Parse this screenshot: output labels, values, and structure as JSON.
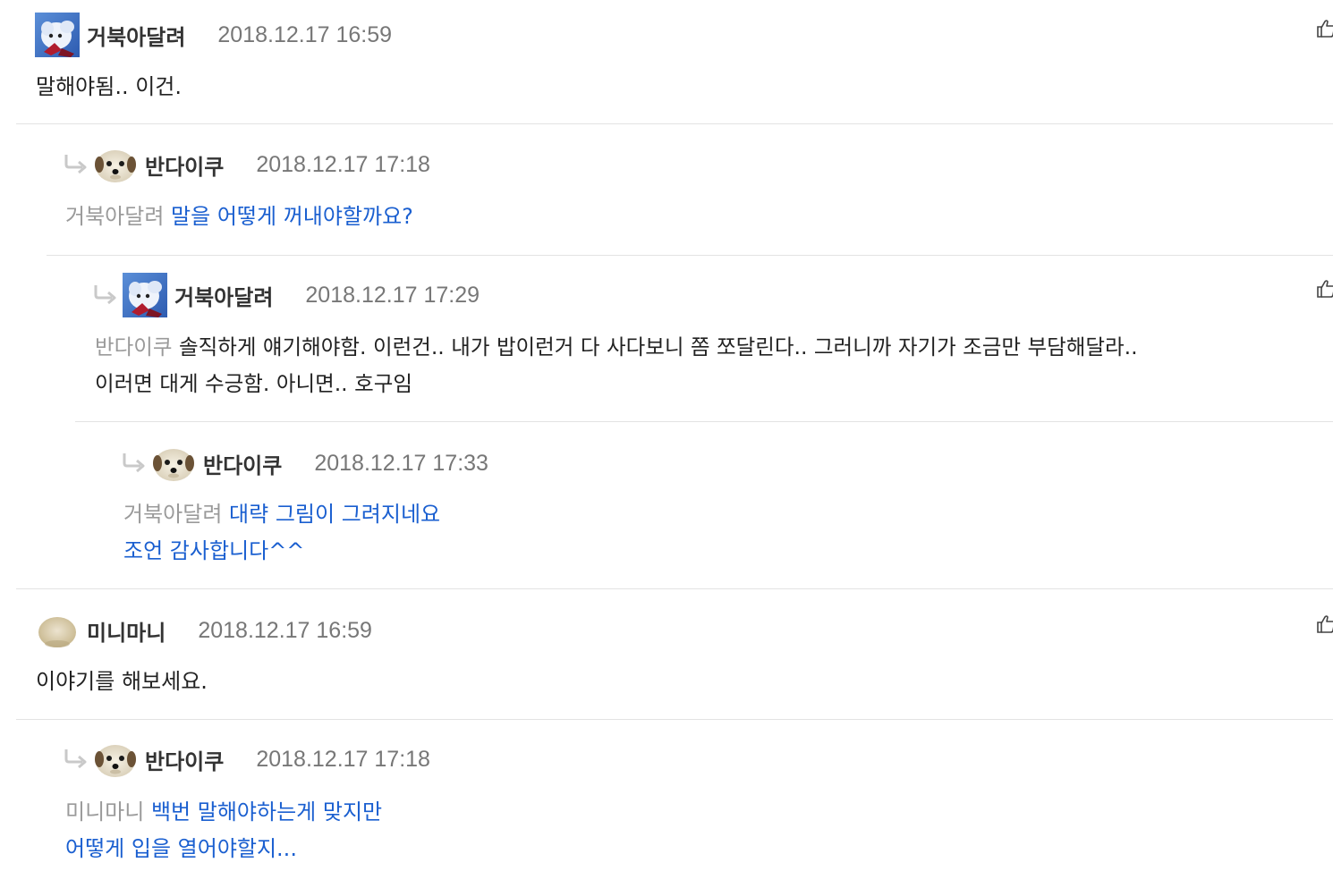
{
  "comments": [
    {
      "author": "거북아달려",
      "date": "2018.12.17 16:59",
      "text": "말해야됨.. 이건."
    },
    {
      "author": "반다이쿠",
      "date": "2018.12.17 17:18",
      "mention": "거북아달려",
      "text": "말을 어떻게 꺼내야할까요?"
    },
    {
      "author": "거북아달려",
      "date": "2018.12.17 17:29",
      "mention": "반다이쿠",
      "text_line1": "솔직하게 얘기해야함. 이런건.. 내가 밥이런거 다 사다보니 쫌 쪼달린다.. 그러니까 자기가 조금만 부담해달라..",
      "text_line2": "이러면 대게 수긍함. 아니면.. 호구임"
    },
    {
      "author": "반다이쿠",
      "date": "2018.12.17 17:33",
      "mention": "거북아달려",
      "text_line1": "대략 그림이 그려지네요",
      "text_line2": "조언 감사합니다^^"
    },
    {
      "author": "미니마니",
      "date": "2018.12.17 16:59",
      "text": "이야기를 해보세요."
    },
    {
      "author": "반다이쿠",
      "date": "2018.12.17 17:18",
      "mention": "미니마니",
      "text_line1": "백번 말해야하는게 맞지만",
      "text_line2": "어떻게 입을 열어야할지..."
    }
  ],
  "icons": {
    "like": "thumbs-up-icon",
    "reply": "reply-arrow-icon"
  },
  "colors": {
    "reply_text": "#1a5fd0",
    "mention": "#9a9a9a",
    "date": "#777777"
  }
}
